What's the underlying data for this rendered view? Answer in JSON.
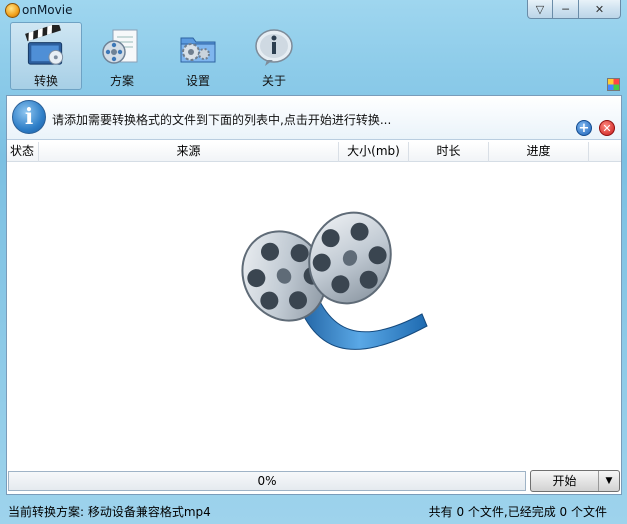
{
  "window": {
    "title": "onMovie",
    "menu_glyph": "▽",
    "minimize_glyph": "─",
    "close_glyph": "✕"
  },
  "toolbar": {
    "items": [
      {
        "label": "转换",
        "icon": "clapperboard-icon",
        "active": true
      },
      {
        "label": "方案",
        "icon": "film-reel-document-icon",
        "active": false
      },
      {
        "label": "设置",
        "icon": "folder-settings-icon",
        "active": false
      },
      {
        "label": "关于",
        "icon": "info-icon",
        "active": false
      }
    ]
  },
  "info": {
    "text": "请添加需要转换格式的文件到下面的列表中,点击开始进行转换...",
    "add_glyph": "+",
    "remove_glyph": "✕"
  },
  "table": {
    "columns": [
      "状态",
      "来源",
      "大小(mb)",
      "时长",
      "进度"
    ],
    "rows": []
  },
  "progress": {
    "value": 0,
    "text": "0%"
  },
  "start_button": {
    "label": "开始",
    "arrow": "▼"
  },
  "status": {
    "left": "当前转换方案: 移动设备兼容格式mp4",
    "right": "共有 0 个文件,已经完成 0 个文件"
  },
  "colors": {
    "accent": "#2f7fc8",
    "frame": "#8ccbe9",
    "progress_fill": "#7ec26e"
  }
}
